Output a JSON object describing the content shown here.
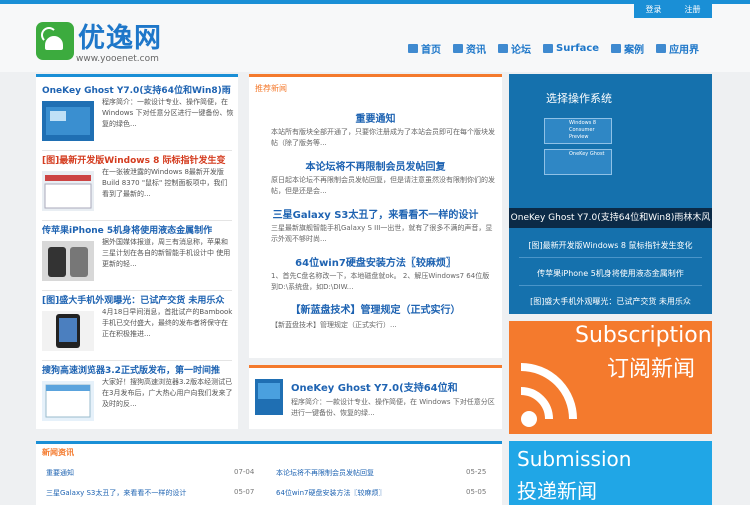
{
  "top": {
    "login_label": "登录",
    "register_label": "注册"
  },
  "brand": {
    "name": "优逸网",
    "url": "www.yooenet.com"
  },
  "nav": [
    {
      "label": "首页",
      "icon": "home-icon"
    },
    {
      "label": "资讯",
      "icon": "thumb-icon"
    },
    {
      "label": "论坛",
      "icon": "chat-icon"
    },
    {
      "label": "Surface",
      "icon": "surface-icon"
    },
    {
      "label": "案例",
      "icon": "case-icon"
    },
    {
      "label": "应用界",
      "icon": "grid-icon"
    }
  ],
  "left_items": [
    {
      "title": "OneKey Ghost Y7.0(支持64位和Win8)雨",
      "desc": "程序简介：一款设计专业、操作简便，在 Windows 下对任意分区进行一键备份、恢复的绿色...",
      "red": false
    },
    {
      "title": "[图]最新开发版Windows 8 际标指针发生变",
      "desc": "在一张被泄露的Windows 8最新开发版Build 8370 \"鼠标\" 控制面板项中，我们看到了最新的...",
      "red": true
    },
    {
      "title": "传苹果iPhone 5机身将使用液态金属制作",
      "desc": "据外国媒体报道，周三有消息称，苹果和三星计划在各自的新智能手机设计中 使用更新的轻...",
      "red": false
    },
    {
      "title": "[图]盛大手机外观曝光：已试产交货 未用乐众",
      "desc": "4月18日早间消息，首批试产的Bambook手机已交付盛大，最终的发布者将保守在正在积极推进...",
      "red": false
    },
    {
      "title": "搜狗高速浏览器3.2正式版发布，第一时间推",
      "desc": "大家好！搜狗高速浏览器3.2版本经测试已在3月发布后，广大热心用户向我们发来了及时的反...",
      "red": false
    }
  ],
  "center": {
    "section_title": "推荐新闻",
    "blocks": [
      {
        "head": "重要通知",
        "desc": "本站所有版块全部开通了，只要你注册成为了本站会员即可在每个版块发帖（除了版务等..."
      },
      {
        "head": "本论坛将不再限制会员发帖回复",
        "desc": "原日起本论坛不再限制会员发帖回复，但是请注意虽然没有限制你们的发帖，但是还是会..."
      },
      {
        "head": "三星Galaxy S3太丑了，来看看不一样的设计",
        "desc": "三星最新旗舰智能手机Galaxy S III一出世，就有了很多不满的声音，显示外观不够时尚..."
      },
      {
        "head": "64位win7硬盘安装方法〖较麻烦〗",
        "desc": "1、首先C盘名称改一下，本地磁盘就ok。 2、解压Windows7 64位版到D:\\系统盘，如D:\\DIW..."
      },
      {
        "head": "【新蓝盘技术】管理规定（正式实行）",
        "desc": "【新蓝盘技术】管理规定（正式实行）..."
      }
    ],
    "feature_title": "OneKey Ghost Y7.0(支持64位和",
    "feature_desc": "程序简介：一款设计专业、操作简便，在 Windows 下对任意分区进行一键备份、恢复的绿..."
  },
  "right": {
    "os_title": "选择操作系统",
    "os_cards": [
      {
        "label": "Windows 8 Consumer Preview"
      },
      {
        "label": "OneKey Ghost"
      }
    ],
    "highlight": "OneKey Ghost Y7.0(支持64位和Win8)雨林木风",
    "links": [
      "[图]最新开发版Windows 8 鼠标指针发生变化",
      "传苹果iPhone 5机身将使用液态金属制作",
      "[图]盛大手机外观曝光：已试产交货 未用乐众"
    ]
  },
  "subscription": {
    "en": "Subscription",
    "cn": "订阅新闻"
  },
  "submission": {
    "en": "Submission",
    "cn": "投递新闻"
  },
  "news_list": {
    "title": "新闻资讯",
    "rows": [
      {
        "title": "重要通知",
        "date": "07-04"
      },
      {
        "title": "本论坛将不再限制会员发帖回复",
        "date": "05-25"
      },
      {
        "title": "三星Galaxy S3太丑了，来看看不一样的设计",
        "date": "05-07"
      },
      {
        "title": "64位win7硬盘安装方法〖较麻烦〗",
        "date": "05-05"
      }
    ]
  },
  "colors": {
    "blue": "#1a8fd6",
    "orange": "#f47a2d",
    "dark_blue": "#1571ad",
    "green": "#3cab3e"
  }
}
